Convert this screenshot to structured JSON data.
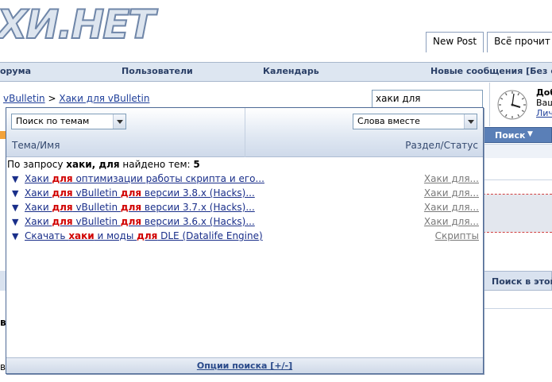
{
  "header": {
    "logo_text": "ХИ.НЕТ",
    "tabs": [
      "New Post",
      "Всё прочит"
    ]
  },
  "navbar": {
    "items": [
      "орума",
      "Пользователи",
      "Календарь",
      "Новые сообщения [Без фл"
    ]
  },
  "breadcrumb": {
    "first": "vBulletin",
    "separator": ">",
    "second": "Хаки для vBulletin"
  },
  "search": {
    "value": "хаки для"
  },
  "welcome": {
    "title": "Доб",
    "line2": "Ваш",
    "link": "Лич"
  },
  "background": {
    "search_menu": "Поиск",
    "search_in_thread": "Поиск в этой",
    "left_letters": [
      "в",
      "в"
    ]
  },
  "popup": {
    "search_mode": "Поиск по темам",
    "word_mode": "Слова вместе",
    "col_title": "Тема/Имя",
    "col_section": "Раздел/Статус",
    "result_prefix": "По запросу",
    "result_query": "хаки, для",
    "result_middle": "найдено тем:",
    "result_count": "5",
    "rows": [
      {
        "pre": "Хаки ",
        "hl1": "для",
        "mid": " оптимизации работы скрипта и его...",
        "hl2": "",
        "post": "",
        "section": "Хаки для..."
      },
      {
        "pre": "Хаки ",
        "hl1": "для",
        "mid": " vBulletin ",
        "hl2": "для",
        "post": " версии 3.8.x (Hacks)...",
        "section": "Хаки для..."
      },
      {
        "pre": "Хаки ",
        "hl1": "для",
        "mid": " vBulletin ",
        "hl2": "для",
        "post": " версии 3.7.x (Hacks)...",
        "section": "Хаки для..."
      },
      {
        "pre": "Хаки ",
        "hl1": "для",
        "mid": " vBulletin ",
        "hl2": "для",
        "post": " версии 3.6.x (Hacks)...",
        "section": "Хаки для..."
      },
      {
        "pre": "Скачать ",
        "hl1": "хаки",
        "mid": " и моды ",
        "hl2": "для",
        "post": " DLE (Datalife Engine)",
        "section": "Скрипты"
      }
    ],
    "footer_link": "Опции поиска [+/-]"
  }
}
